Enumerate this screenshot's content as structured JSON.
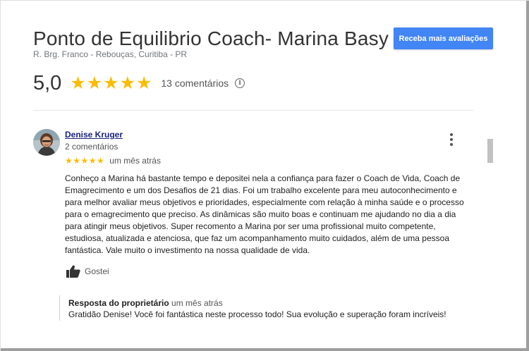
{
  "business": {
    "name": "Ponto de Equilibrio Coach- Marina Basy",
    "address": "R. Brg. Franco - Rebouças, Curitiba - PR",
    "cta_label": "Receba mais avaliações",
    "rating": "5,0",
    "rating_stars": "★★★★★",
    "review_count": "13 comentários",
    "info_icon": "ⓘ"
  },
  "review": {
    "author": "Denise Kruger",
    "author_reviews": "2 comentários",
    "stars": "★★★★★",
    "rating_value": 5,
    "time": "um mês atrás",
    "text": "Conheço a Marina há bastante tempo e depositei nela a confiança para fazer o Coach de Vida, Coach de Emagrecimento e um dos Desafios de 21 dias. Foi um trabalho excelente para meu autoconhecimento e para melhor avaliar meus objetivos e prioridades, especialmente com relação à minha saúde e o processo para o emagrecimento que preciso. As dinâmicas são muito boas e continuam me ajudando no dia a dia para atingir meus objetivos. Super recomento a Marina por ser uma profissional muito competente, estudiosa, atualizada e atenciosa, que faz um acompanhamento muito cuidados, além de uma pessoa fantástica. Vale muito o investimento na nossa qualidade de vida.",
    "like_label": "Gostei"
  },
  "reply": {
    "owner_label": "Resposta do proprietário",
    "time": "um mês atrás",
    "text": "Gratidão Denise! Você foi fantástica neste processo todo! Sua evolução e superação foram incríveis!"
  },
  "colors": {
    "accent": "#4285f4",
    "star": "#fbbc04",
    "link": "#1a237e"
  }
}
